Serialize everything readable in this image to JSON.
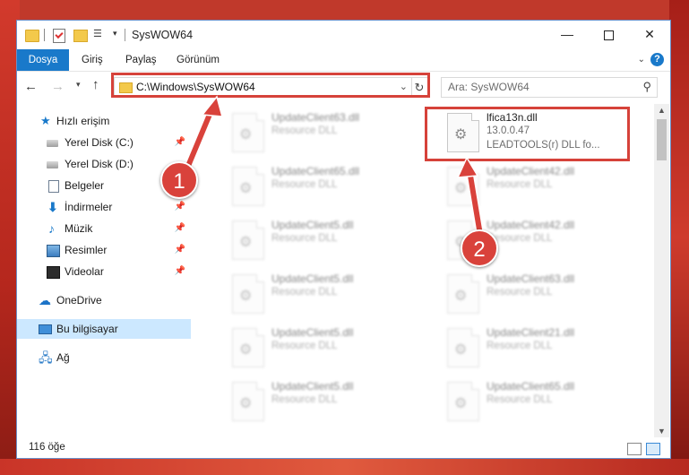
{
  "window": {
    "title": "SysWOW64",
    "min_glyph": "—",
    "close_glyph": "✕"
  },
  "ribbon": {
    "tabs": [
      "Dosya",
      "Giriş",
      "Paylaş",
      "Görünüm"
    ],
    "help_glyph": "?"
  },
  "navigation": {
    "address": "C:\\Windows\\SysWOW64",
    "search_placeholder": "Ara: SysWOW64"
  },
  "sidebar": {
    "items": [
      {
        "label": "Hızlı erişim",
        "icon": "star-icon"
      },
      {
        "label": "Yerel Disk (C:)",
        "icon": "drive-icon",
        "pinned": true
      },
      {
        "label": "Yerel Disk (D:)",
        "icon": "drive-icon"
      },
      {
        "label": "Belgeler",
        "icon": "documents-icon"
      },
      {
        "label": "İndirmeler",
        "icon": "download-icon",
        "pinned": true
      },
      {
        "label": "Müzik",
        "icon": "music-icon",
        "pinned": true
      },
      {
        "label": "Resimler",
        "icon": "pictures-icon",
        "pinned": true
      },
      {
        "label": "Videolar",
        "icon": "video-icon",
        "pinned": true
      },
      {
        "label": "OneDrive",
        "icon": "cloud-icon"
      },
      {
        "label": "Bu bilgisayar",
        "icon": "computer-icon",
        "selected": true
      },
      {
        "label": "Ağ",
        "icon": "network-icon"
      }
    ]
  },
  "files": {
    "left": [
      {
        "name": "UpdateClient63.dll",
        "type": "Resource DLL"
      },
      {
        "name": "UpdateClient65.dll",
        "type": "Resource DLL"
      },
      {
        "name": "UpdateClient5.dll",
        "type": "Resource DLL"
      },
      {
        "name": "UpdateClient5.dll",
        "type": "Resource DLL"
      },
      {
        "name": "UpdateClient5.dll",
        "type": "Resource DLL"
      },
      {
        "name": "UpdateClient5.dll",
        "type": "Resource DLL"
      }
    ],
    "right": [
      {
        "name": "lfica13n.dll",
        "version": "13.0.0.47",
        "description": "LEADTOOLS(r) DLL fo..."
      },
      {
        "name": "UpdateClient42.dll",
        "type": "Resource DLL"
      },
      {
        "name": "UpdateClient42.dll",
        "type": "Resource DLL"
      },
      {
        "name": "UpdateClient63.dll",
        "type": "Resource DLL"
      },
      {
        "name": "UpdateClient21.dll",
        "type": "Resource DLL"
      },
      {
        "name": "UpdateClient65.dll",
        "type": "Resource DLL"
      }
    ]
  },
  "status": {
    "item_count": "116 öğe"
  },
  "annotations": {
    "step1": "1",
    "step2": "2",
    "highlight_color": "#d6423a"
  }
}
